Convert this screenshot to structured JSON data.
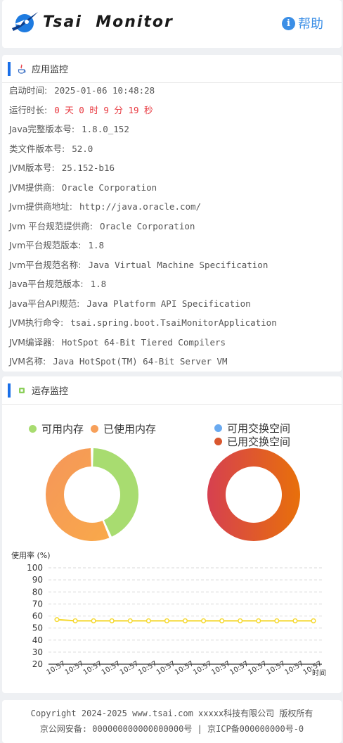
{
  "header": {
    "brand": "Tsai  Monitor",
    "help_label": "帮助",
    "help_icon_glyph": "i"
  },
  "app_section": {
    "title": "应用监控",
    "icon": "java-icon",
    "rows": [
      {
        "key": "启动时间:",
        "value": "2025-01-06 10:48:28",
        "highlight": false
      },
      {
        "key": "运行时长:",
        "value": "0 天 0 时 9 分 19 秒",
        "highlight": true
      },
      {
        "key": "Java完整版本号:",
        "value": "1.8.0_152",
        "highlight": false
      },
      {
        "key": "类文件版本号:",
        "value": "52.0",
        "highlight": false
      },
      {
        "key": "JVM版本号:",
        "value": "25.152-b16",
        "highlight": false
      },
      {
        "key": "JVM提供商:",
        "value": "Oracle Corporation",
        "highlight": false
      },
      {
        "key": "Jvm提供商地址:",
        "value": "http://java.oracle.com/",
        "highlight": false
      },
      {
        "key": "Jvm 平台规范提供商:",
        "value": "Oracle Corporation",
        "highlight": false
      },
      {
        "key": "Jvm平台规范版本:",
        "value": "1.8",
        "highlight": false
      },
      {
        "key": "Jvm平台规范名称:",
        "value": "Java Virtual Machine Specification",
        "highlight": false
      },
      {
        "key": "Java平台规范版本:",
        "value": "1.8",
        "highlight": false
      },
      {
        "key": "Java平台API规范:",
        "value": "Java Platform API Specification",
        "highlight": false
      },
      {
        "key": "JVM执行命令:",
        "value": "tsai.spring.boot.TsaiMonitorApplication",
        "highlight": false
      },
      {
        "key": "JVM编译器:",
        "value": "HotSpot 64-Bit Tiered Compilers",
        "highlight": false
      },
      {
        "key": "JVM名称:",
        "value": "Java HotSpot(TM) 64-Bit Server VM",
        "highlight": false
      }
    ]
  },
  "memory_section": {
    "title": "运存监控",
    "icon": "chip-icon"
  },
  "colors": {
    "accent": "#1a6fe8",
    "free_memory": "#a8dc70",
    "used_memory": "#f7a05a",
    "free_swap": "#6aaaf0",
    "used_swap": "#d9572f",
    "line": "#f5d82c",
    "runtime": "#e8363d"
  },
  "chart_data": [
    {
      "type": "pie",
      "donut": true,
      "legend": [
        "可用内存",
        "已使用内存"
      ],
      "values": [
        43.5,
        56.5
      ],
      "legend_position": "top"
    },
    {
      "type": "pie",
      "donut": true,
      "legend": [
        "可用交换空间",
        "已用交换空间"
      ],
      "values": [
        0,
        100
      ],
      "legend_position": "top-right"
    },
    {
      "type": "line",
      "ylabel": "使用率 (%)",
      "xlabel": "时间",
      "ylim": [
        20,
        100
      ],
      "yticks": [
        20,
        30,
        40,
        50,
        60,
        70,
        80,
        90,
        100
      ],
      "categories": [
        "10:57",
        "10:57",
        "10:57",
        "10:57",
        "10:57",
        "10:57",
        "10:57",
        "10:57",
        "10:57",
        "10:57",
        "10:57",
        "10:57",
        "10:57",
        "10:57",
        "10:57"
      ],
      "values": [
        57,
        56,
        56,
        56,
        56,
        56,
        56,
        56,
        56,
        56,
        56,
        56,
        56,
        56,
        56
      ],
      "grid": true
    }
  ],
  "footer": {
    "line1": "Copyright 2024-2025 www.tsai.com xxxxx科技有限公司 版权所有",
    "line2": "京公网安备: 000000000000000000号 | 京ICP备000000000号-0"
  }
}
